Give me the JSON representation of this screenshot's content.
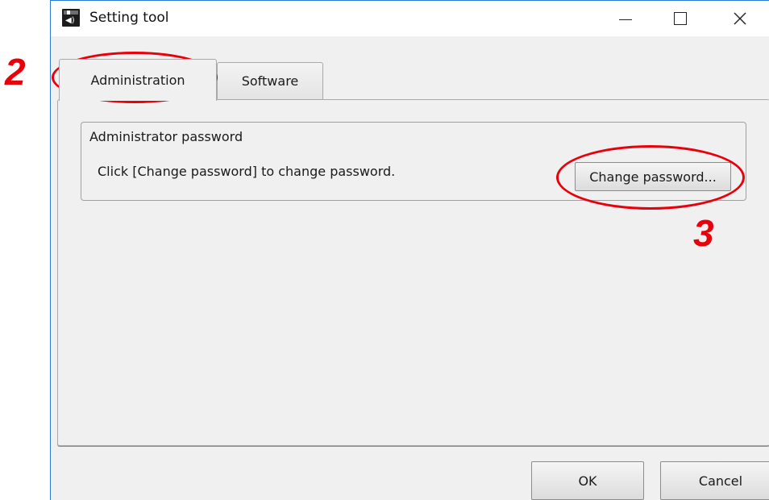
{
  "window": {
    "title": "Setting tool",
    "controls": {
      "minimize": "minimize",
      "maximize": "maximize",
      "close": "close"
    }
  },
  "tabs": [
    {
      "label": "Administration",
      "active": true
    },
    {
      "label": "Software",
      "active": false
    }
  ],
  "admin": {
    "group_title": "Administrator password",
    "message": "Click [Change password] to change password.",
    "change_button": "Change password..."
  },
  "footer": {
    "ok_label": "OK",
    "cancel_label": "Cancel"
  },
  "annotations": {
    "step_2": "2",
    "step_3": "3",
    "color": "#e8000b"
  },
  "icons": [
    "app-icon",
    "minimize-icon",
    "maximize-icon",
    "close-icon"
  ]
}
